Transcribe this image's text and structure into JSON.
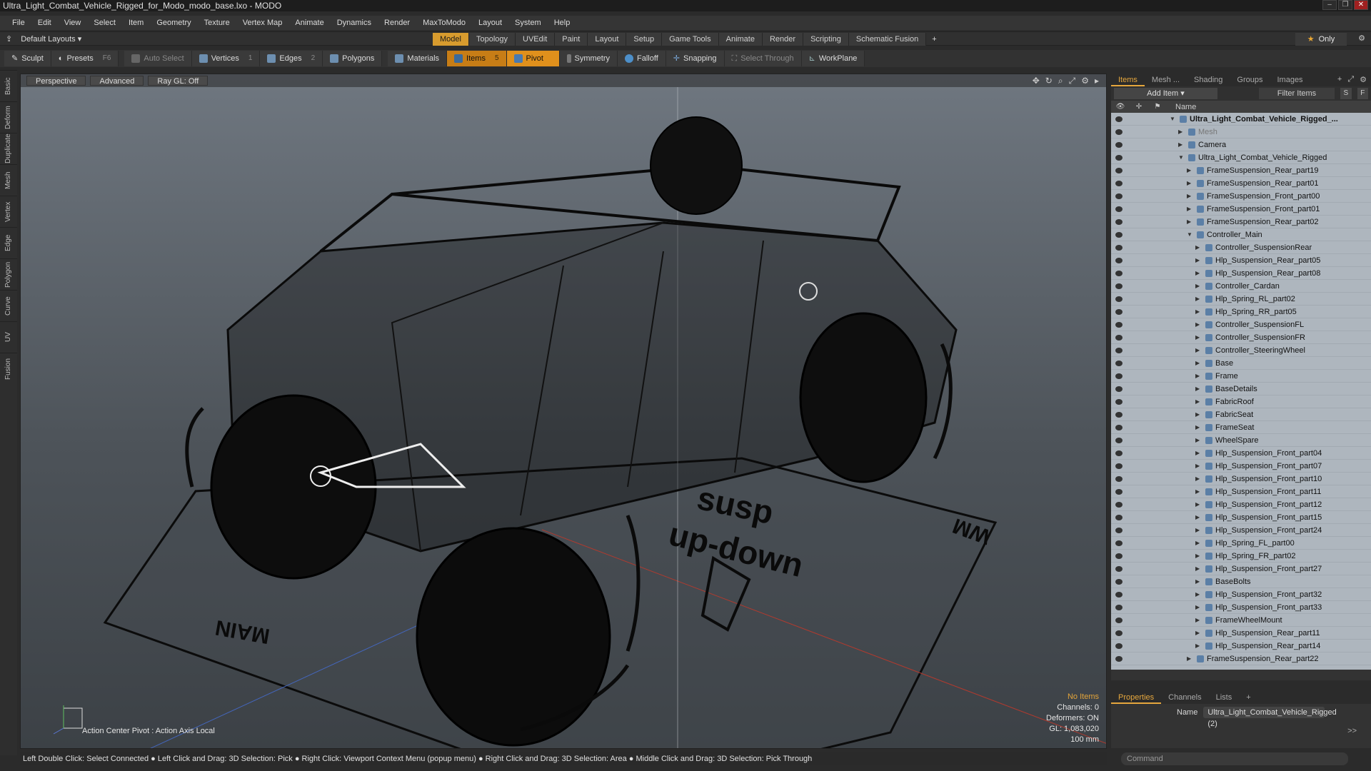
{
  "window": {
    "title": "Ultra_Light_Combat_Vehicle_Rigged_for_Modo_modo_base.lxo - MODO"
  },
  "menu": [
    "File",
    "Edit",
    "View",
    "Select",
    "Item",
    "Geometry",
    "Texture",
    "Vertex Map",
    "Animate",
    "Dynamics",
    "Render",
    "MaxToModo",
    "Layout",
    "System",
    "Help"
  ],
  "layout": {
    "dropdown": "Default Layouts",
    "tabs": [
      "Model",
      "Topology",
      "UVEdit",
      "Paint",
      "Layout",
      "Setup",
      "Game Tools",
      "Animate",
      "Render",
      "Scripting",
      "Schematic Fusion"
    ],
    "active_tab": 0,
    "add": "+",
    "only_label": "Only"
  },
  "toolbar": {
    "sculpt": "Sculpt",
    "presets": "Presets",
    "presets_key": "F6",
    "auto_select": "Auto Select",
    "vertices": "Vertices",
    "vertices_count": "1",
    "edges": "Edges",
    "edges_count": "2",
    "polygons": "Polygons",
    "materials": "Materials",
    "items": "Items",
    "items_count": "5",
    "pivot": "Pivot",
    "symmetry": "Symmetry",
    "falloff": "Falloff",
    "snapping": "Snapping",
    "select_through": "Select Through",
    "workplane": "WorkPlane"
  },
  "left_tabs": [
    "Basic",
    "Deform",
    "Duplicate",
    "Mesh Edit",
    "Vertex",
    "Edge",
    "Polygon",
    "Curve",
    "UV",
    "Fusion"
  ],
  "viewport": {
    "perspective": "Perspective",
    "advanced": "Advanced",
    "raygl": "Ray GL: Off",
    "stats": {
      "no_items": "No Items",
      "channels": "Channels: 0",
      "deformers": "Deformers: ON",
      "gl": "GL: 1,083,020",
      "size": "100 mm"
    },
    "pivot_text": "Action Center Pivot : Action Axis Local",
    "ground_text1": "susp",
    "ground_text2": "up-down",
    "ground_text3": "MAIN",
    "ground_text4": "WM"
  },
  "status_bar": "Left Double Click: Select Connected ● Left Click and Drag: 3D Selection: Pick ● Right Click: Viewport Context Menu (popup menu) ● Right Click and Drag: 3D Selection: Area ● Middle Click and Drag: 3D Selection: Pick Through",
  "items_panel": {
    "tabs": [
      "Items",
      "Mesh ...",
      "Shading",
      "Groups",
      "Images"
    ],
    "add_item": "Add Item",
    "filter": "Filter Items",
    "s": "S",
    "f": "F",
    "col_name": "Name",
    "rows": [
      {
        "label": "Ultra_Light_Combat_Vehicle_Rigged_...",
        "indent": 0,
        "bold": true
      },
      {
        "label": "Mesh",
        "indent": 1,
        "dim": true
      },
      {
        "label": "Camera",
        "indent": 1
      },
      {
        "label": "Ultra_Light_Combat_Vehicle_Rigged",
        "indent": 1
      },
      {
        "label": "FrameSuspension_Rear_part19",
        "indent": 2
      },
      {
        "label": "FrameSuspension_Rear_part01",
        "indent": 2
      },
      {
        "label": "FrameSuspension_Front_part00",
        "indent": 2
      },
      {
        "label": "FrameSuspension_Front_part01",
        "indent": 2
      },
      {
        "label": "FrameSuspension_Rear_part02",
        "indent": 2
      },
      {
        "label": "Controller_Main",
        "indent": 2
      },
      {
        "label": "Controller_SuspensionRear",
        "indent": 3
      },
      {
        "label": "Hlp_Suspension_Rear_part05",
        "indent": 3
      },
      {
        "label": "Hlp_Suspension_Rear_part08",
        "indent": 3
      },
      {
        "label": "Controller_Cardan",
        "indent": 3
      },
      {
        "label": "Hlp_Spring_RL_part02",
        "indent": 3
      },
      {
        "label": "Hlp_Spring_RR_part05",
        "indent": 3
      },
      {
        "label": "Controller_SuspensionFL",
        "indent": 3
      },
      {
        "label": "Controller_SuspensionFR",
        "indent": 3
      },
      {
        "label": "Controller_SteeringWheel",
        "indent": 3
      },
      {
        "label": "Base",
        "indent": 3
      },
      {
        "label": "Frame",
        "indent": 3
      },
      {
        "label": "BaseDetails",
        "indent": 3
      },
      {
        "label": "FabricRoof",
        "indent": 3
      },
      {
        "label": "FabricSeat",
        "indent": 3
      },
      {
        "label": "FrameSeat",
        "indent": 3
      },
      {
        "label": "WheelSpare",
        "indent": 3
      },
      {
        "label": "Hlp_Suspension_Front_part04",
        "indent": 3
      },
      {
        "label": "Hlp_Suspension_Front_part07",
        "indent": 3
      },
      {
        "label": "Hlp_Suspension_Front_part10",
        "indent": 3
      },
      {
        "label": "Hlp_Suspension_Front_part11",
        "indent": 3
      },
      {
        "label": "Hlp_Suspension_Front_part12",
        "indent": 3
      },
      {
        "label": "Hlp_Suspension_Front_part15",
        "indent": 3
      },
      {
        "label": "Hlp_Suspension_Front_part24",
        "indent": 3
      },
      {
        "label": "Hlp_Spring_FL_part00",
        "indent": 3
      },
      {
        "label": "Hlp_Spring_FR_part02",
        "indent": 3
      },
      {
        "label": "Hlp_Suspension_Front_part27",
        "indent": 3
      },
      {
        "label": "BaseBolts",
        "indent": 3
      },
      {
        "label": "Hlp_Suspension_Front_part32",
        "indent": 3
      },
      {
        "label": "Hlp_Suspension_Front_part33",
        "indent": 3
      },
      {
        "label": "FrameWheelMount",
        "indent": 3
      },
      {
        "label": "Hlp_Suspension_Rear_part11",
        "indent": 3
      },
      {
        "label": "Hlp_Suspension_Rear_part14",
        "indent": 3
      },
      {
        "label": "FrameSuspension_Rear_part22",
        "indent": 2
      }
    ]
  },
  "properties": {
    "tabs": [
      "Properties",
      "Channels",
      "Lists"
    ],
    "name_label": "Name",
    "name_value": "Ultra_Light_Combat_Vehicle_Rigged (2)",
    "more": ">>"
  },
  "command": {
    "placeholder": "Command"
  }
}
